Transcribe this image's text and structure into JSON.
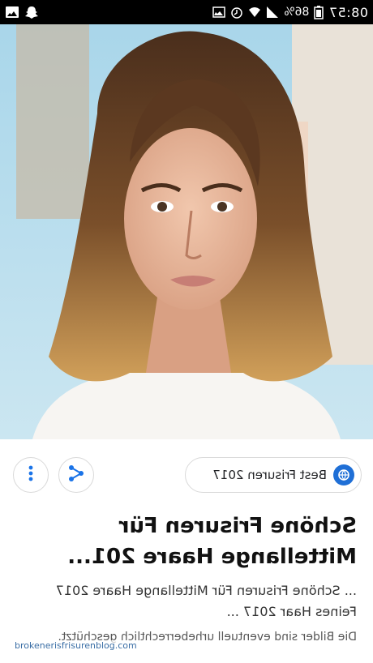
{
  "statusbar": {
    "time": "08:57",
    "battery": "86%",
    "icons": [
      "image-icon",
      "snapchat-ghost-icon",
      "photo-icon",
      "alarm-icon",
      "signal-icon",
      "wifi-icon",
      "battery-icon"
    ]
  },
  "result": {
    "source_name": "Best Frisuren 2017",
    "title": "Schöne Frisuren Für Mittellange Haare 201...",
    "description": "... Schöne Frisuren Für Mittellange Haare 2017 Feines Haar 2017 ...",
    "copyright_note": "Die Bilder sind eventuell urheberrechtlich geschützt."
  },
  "watermark": {
    "text": "brokenerisfrisurenblog.com"
  },
  "colors": {
    "accent": "#1f6fd6",
    "status_bar": "#000000",
    "chip_border": "#d9d9d9",
    "share_icon": "#1a73e8"
  }
}
